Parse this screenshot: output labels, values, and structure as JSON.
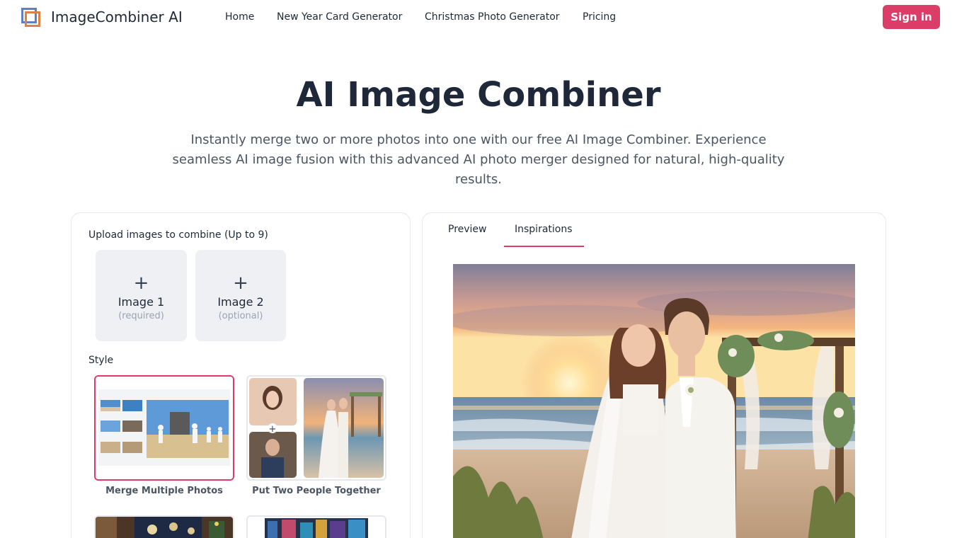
{
  "brand": {
    "name": "ImageCombiner AI"
  },
  "nav": {
    "links": [
      "Home",
      "New Year Card Generator",
      "Christmas Photo Generator",
      "Pricing"
    ],
    "signin": "Sign in"
  },
  "hero": {
    "title": "AI Image Combiner",
    "subtitle": "Instantly merge two or more photos into one with our free AI Image Combiner. Experience seamless AI image fusion with this advanced AI photo merger designed for natural, high-quality results."
  },
  "upload": {
    "label": "Upload images to combine (Up to 9)",
    "slots": [
      {
        "plus": "+",
        "label": "Image 1",
        "sub": "(required)"
      },
      {
        "plus": "+",
        "label": "Image 2",
        "sub": "(optional)"
      }
    ]
  },
  "styles": {
    "label": "Style",
    "cards": [
      {
        "name": "Merge Multiple Photos",
        "selected": true
      },
      {
        "name": "Put Two People Together",
        "selected": false
      }
    ]
  },
  "tabs": {
    "items": [
      "Preview",
      "Inspirations"
    ],
    "active": "Inspirations"
  },
  "colors": {
    "accent": "#dc3c68",
    "heading": "#1e2838",
    "muted": "#4b5563",
    "border": "#e5e7eb"
  }
}
